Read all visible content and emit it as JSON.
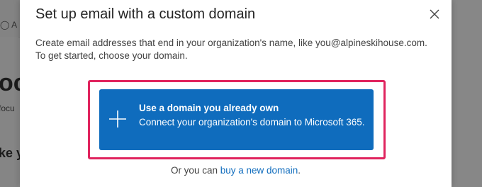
{
  "background": {
    "user_fragment": "A",
    "heading_fragment": "oc",
    "subtext_fragment": "focu",
    "heading2_fragment": "ke y"
  },
  "dialog": {
    "title": "Set up email with a custom domain",
    "close_icon": "close-icon",
    "description": "Create email addresses that end in your organization's name, like you@alpineskihouse.com. To get started, choose your domain.",
    "option": {
      "icon": "plus-icon",
      "heading": "Use a domain you already own",
      "subtitle": "Connect your organization's domain to Microsoft 365."
    },
    "footer_prefix": "Or you can",
    "footer_link": "buy a new domain",
    "footer_suffix": "."
  },
  "colors": {
    "primary": "#0f6cbd",
    "highlight": "#e0245e"
  }
}
